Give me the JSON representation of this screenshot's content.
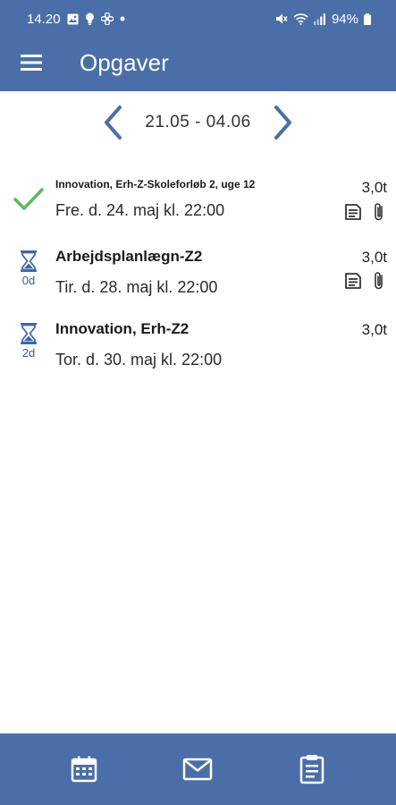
{
  "status_bar": {
    "time": "14.20",
    "battery": "94%"
  },
  "header": {
    "title": "Opgaver"
  },
  "week_nav": {
    "range": "21.05 - 04.06"
  },
  "tasks": [
    {
      "name": "Innovation, Erh-Z-Skoleforløb 2, uge 12",
      "due": "Fre. d. 24. maj kl. 22:00",
      "hours": "3,0t",
      "status": "done",
      "days": "",
      "has_document": true,
      "has_attachment": true
    },
    {
      "name": "Arbejdsplanlægn-Z2",
      "due": "Tir. d. 28. maj kl. 22:00",
      "hours": "3,0t",
      "status": "pending",
      "days": "0d",
      "has_document": true,
      "has_attachment": true
    },
    {
      "name": "Innovation, Erh-Z2",
      "due": "Tor. d. 30. maj kl. 22:00",
      "hours": "3,0t",
      "status": "pending",
      "days": "2d",
      "has_document": false,
      "has_attachment": false
    }
  ],
  "bottom_nav": [
    {
      "icon": "calendar-icon"
    },
    {
      "icon": "mail-icon"
    },
    {
      "icon": "clipboard-icon"
    }
  ],
  "colors": {
    "primary": "#4a6ea8",
    "check_green": "#5cb85c",
    "hourglass_blue": "#3f67a8"
  }
}
